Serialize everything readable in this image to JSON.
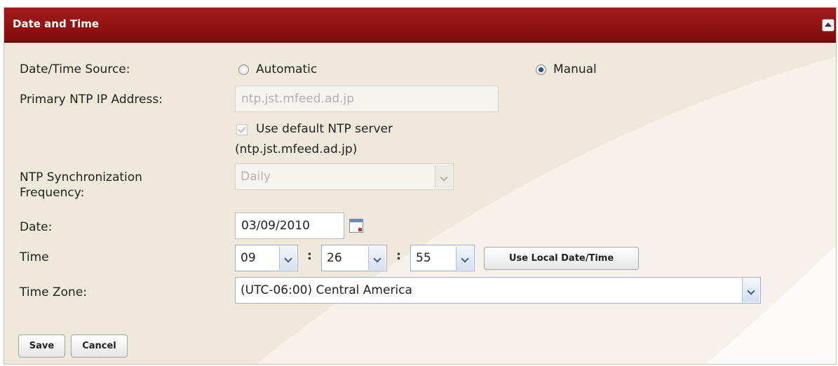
{
  "header": {
    "title": "Date and Time"
  },
  "form": {
    "source": {
      "label": "Date/Time Source:",
      "automatic_label": "Automatic",
      "manual_label": "Manual",
      "selected": "Manual"
    },
    "ntp_ip": {
      "label": "Primary NTP IP Address:",
      "value": "ntp.jst.mfeed.ad.jp"
    },
    "default_ntp": {
      "label": "Use default NTP server",
      "detail": "(ntp.jst.mfeed.ad.jp)",
      "checked": true
    },
    "sync_freq": {
      "label_line1": "NTP Synchronization",
      "label_line2": "Frequency:",
      "value": "Daily"
    },
    "date": {
      "label": "Date:",
      "value": "03/09/2010"
    },
    "time": {
      "label": "Time",
      "hour": "09",
      "minute": "26",
      "second": "55",
      "separator": ":",
      "use_local_label": "Use Local Date/Time"
    },
    "timezone": {
      "label": "Time Zone:",
      "value": "(UTC-06:00) Central America"
    }
  },
  "actions": {
    "save_label": "Save",
    "cancel_label": "Cancel"
  },
  "colors": {
    "header": "#8b1212",
    "panel": "#efe9db",
    "accent": "#2a4f86"
  }
}
